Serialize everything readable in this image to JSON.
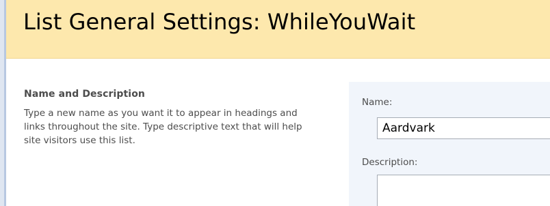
{
  "header": {
    "title": "List General Settings: WhileYouWait"
  },
  "section": {
    "heading": "Name and Description",
    "description": "Type a new name as you want it to appear in headings and links throughout the site. Type descriptive text that will help site visitors use this list."
  },
  "form": {
    "name_label": "Name:",
    "name_value": "Aardvark",
    "description_label": "Description:",
    "description_value": ""
  },
  "colors": {
    "header_background": "#fde8ad",
    "panel_background": "#f1f5fb",
    "text": "#4c4c4c"
  }
}
